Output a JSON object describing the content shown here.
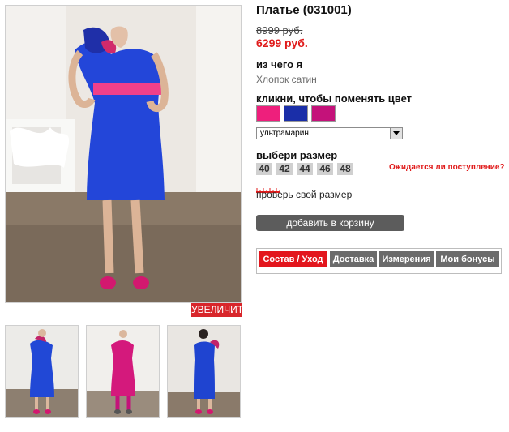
{
  "product": {
    "title": "Платье (031001)",
    "old_price": "8999 руб.",
    "new_price": "6299 руб.",
    "material_label": "из чего я",
    "material_value": "Хлопок сатин",
    "color_label": "кликни, чтобы поменять цвет",
    "size_label": "выбери размер",
    "size_check": "проверь свой размер",
    "waiting_link": "Ожидается ли поступление?",
    "add_to_cart": "добавить в корзину",
    "zoom": "УВЕЛИЧИТЬ"
  },
  "colors": {
    "swatches": [
      "#ee1f7c",
      "#1a2ea8",
      "#c4127a"
    ],
    "selected_name": "ультрамарин",
    "accent_red": "#e3161d"
  },
  "sizes": [
    "40",
    "42",
    "44",
    "46",
    "48"
  ],
  "tabs": [
    {
      "label": "Состав / Уход",
      "active": true
    },
    {
      "label": "Доставка",
      "active": false
    },
    {
      "label": "Измерения",
      "active": false
    },
    {
      "label": "Мои бонусы",
      "active": false
    }
  ]
}
